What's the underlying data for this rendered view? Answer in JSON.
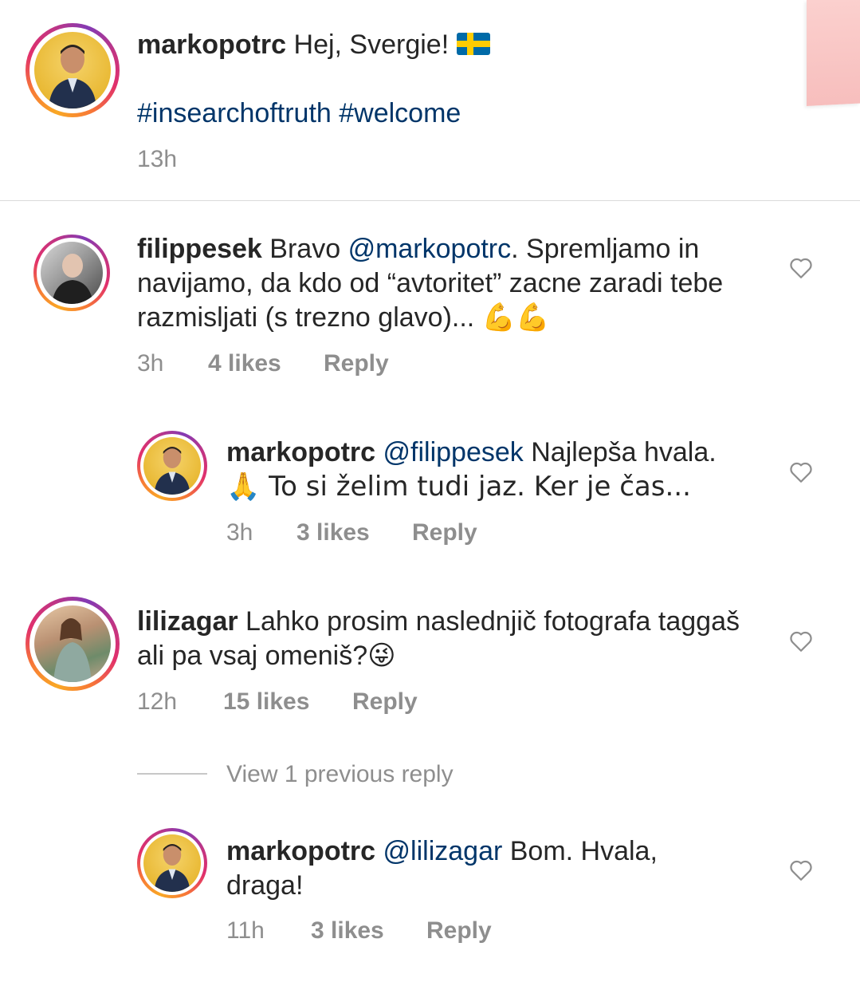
{
  "caption": {
    "username": "markopotrc",
    "text": "Hej, Svergie!",
    "flag_icon": "sweden-flag-icon",
    "hashtags": "#insearchoftruth #welcome",
    "time": "13h"
  },
  "comments": [
    {
      "username": "filippesek",
      "text_before": "Bravo ",
      "mention": "@markopotrc",
      "text_line": ". Spremljamo in navijamo, da kdo od “avtoritet” zacne zaradi tebe razmisljati (s trezno glavo)...",
      "emoji": "💪💪",
      "time": "3h",
      "likes": "4 likes",
      "reply_label": "Reply"
    },
    {
      "username": "markopotrc",
      "mention": "@filippesek",
      "text": " Najlepša hvala.",
      "text2": "🙏 To si želim tudi jaz. Ker je čas...",
      "time": "3h",
      "likes": "3 likes",
      "reply_label": "Reply"
    },
    {
      "username": "lilizagar",
      "text": " Lahko prosim naslednjič fotografa taggaš ali pa vsaj omeniš?",
      "emoji": "😜",
      "time": "12h",
      "likes": "15 likes",
      "reply_label": "Reply"
    },
    {
      "username": "markopotrc",
      "mention": "@lilizagar",
      "text": " Bom. Hvala, draga!",
      "time": "11h",
      "likes": "3 likes",
      "reply_label": "Reply"
    }
  ],
  "view_replies": "View 1 previous reply",
  "icons": {
    "like": "heart-outline-icon"
  }
}
